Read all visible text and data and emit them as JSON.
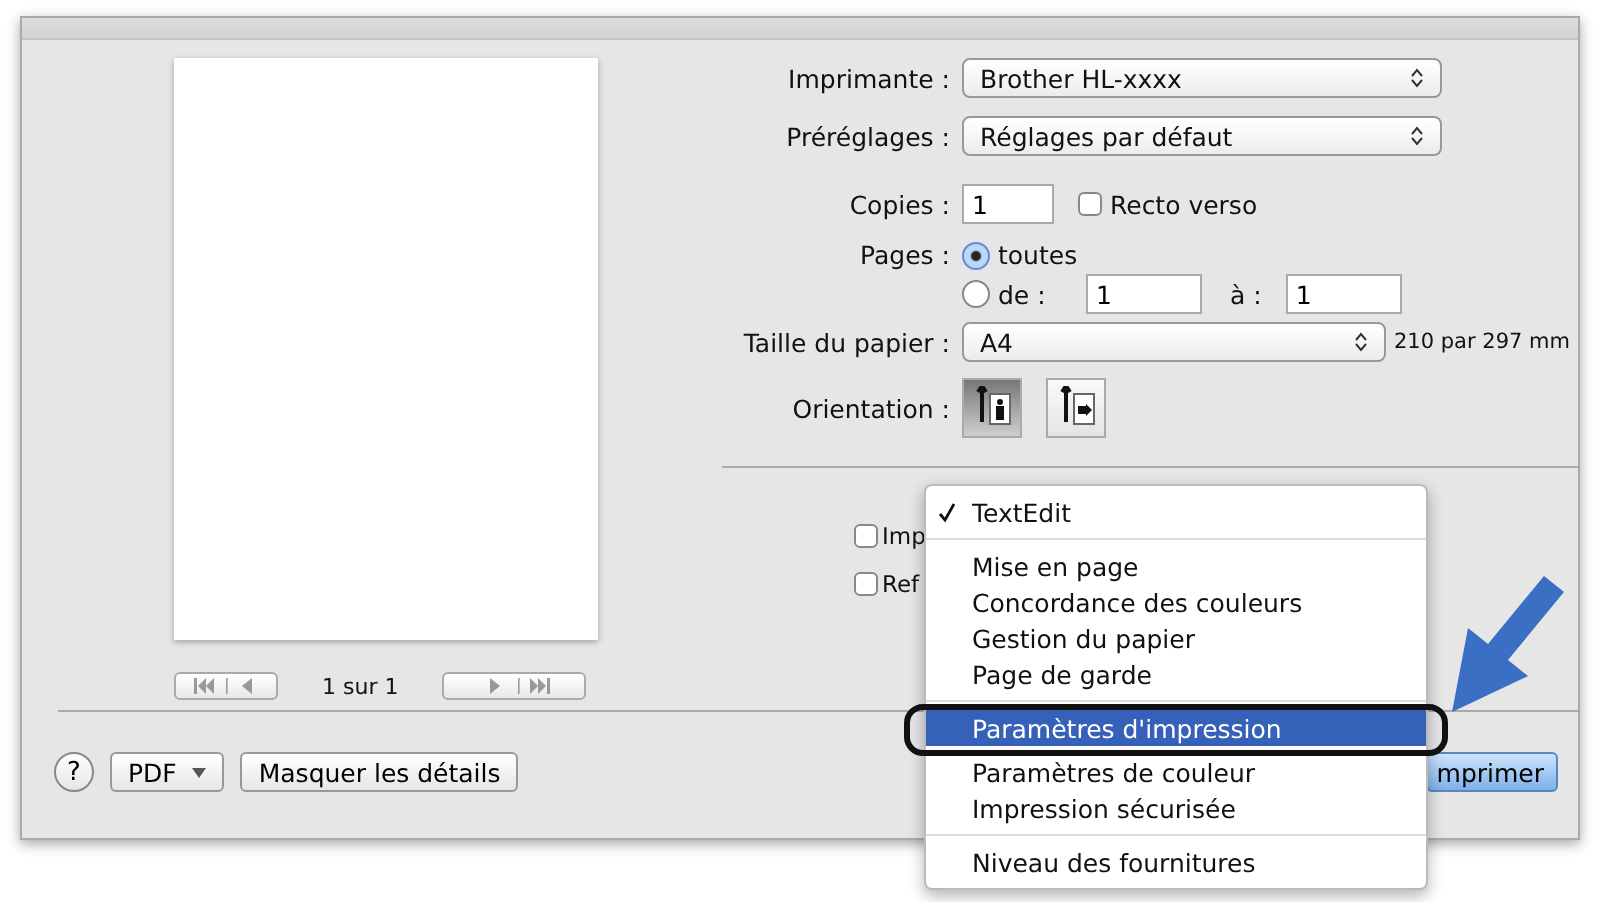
{
  "printer": {
    "label": "Imprimante :",
    "value": "Brother HL-xxxx"
  },
  "presets": {
    "label": "Préréglages :",
    "value": "Réglages par défaut"
  },
  "copies": {
    "label": "Copies :",
    "value": "1"
  },
  "duplex": {
    "label": "Recto verso",
    "checked": false
  },
  "pages": {
    "label": "Pages :",
    "options": [
      {
        "label": "toutes",
        "selected": true
      },
      {
        "label": "de :",
        "selected": false
      }
    ],
    "from": "1",
    "to_label": "à :",
    "to": "1"
  },
  "paper_size": {
    "label": "Taille du papier :",
    "value": "A4",
    "dimensions": "210 par 297 mm"
  },
  "orientation": {
    "label": "Orientation :",
    "options": [
      {
        "kind": "portrait",
        "selected": true
      },
      {
        "kind": "landscape",
        "selected": false
      }
    ]
  },
  "app_options": [
    {
      "label": "Imp",
      "checked": false
    },
    {
      "label": "Ref",
      "checked": false
    }
  ],
  "preview": {
    "page_indicator": "1 sur 1"
  },
  "footer": {
    "help": "?",
    "pdf": "PDF",
    "hide_details": "Masquer les détails",
    "print": "mprimer"
  },
  "menu": {
    "groups": [
      [
        {
          "label": "TextEdit",
          "checked": true,
          "selected": false
        }
      ],
      [
        {
          "label": "Mise en page",
          "checked": false,
          "selected": false
        },
        {
          "label": "Concordance des couleurs",
          "checked": false,
          "selected": false
        },
        {
          "label": "Gestion du papier",
          "checked": false,
          "selected": false
        },
        {
          "label": "Page de garde",
          "checked": false,
          "selected": false
        }
      ],
      [
        {
          "label": "Paramètres d'impression",
          "checked": false,
          "selected": true
        },
        {
          "label": "Paramètres de couleur",
          "checked": false,
          "selected": false
        },
        {
          "label": "Impression sécurisée",
          "checked": false,
          "selected": false
        }
      ],
      [
        {
          "label": "Niveau des fournitures",
          "checked": false,
          "selected": false
        }
      ]
    ]
  }
}
